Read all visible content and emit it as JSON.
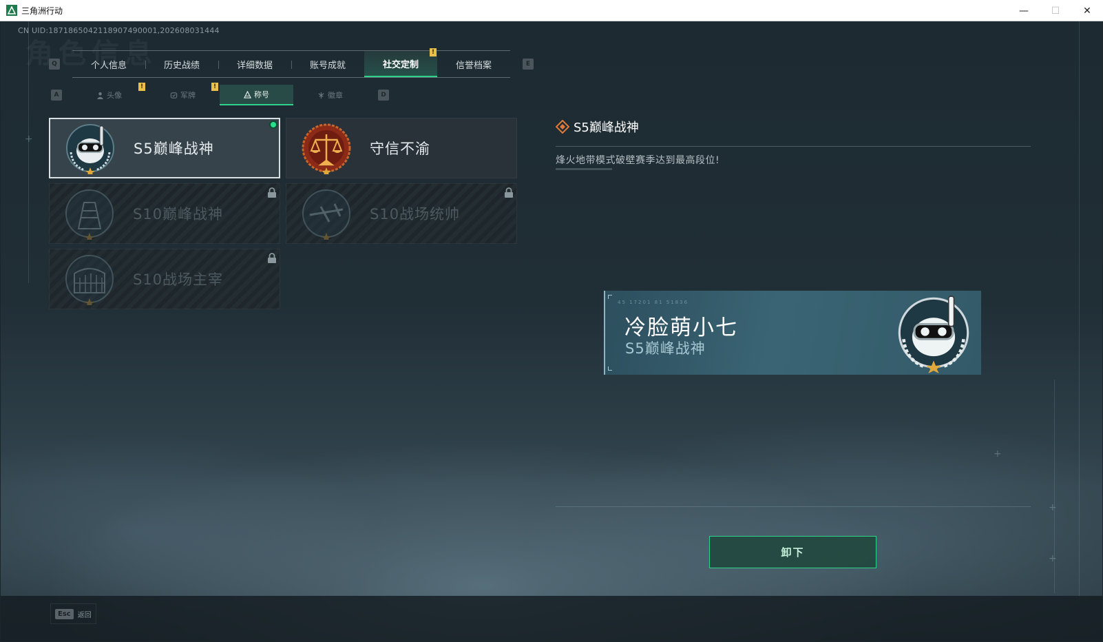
{
  "window": {
    "title": "三角洲行动",
    "minimize": "—",
    "maximize": "☐",
    "close": "✕"
  },
  "uid": "CN UID:1871865042118907490001,202608031444",
  "watermark": "角色信息",
  "tabs": {
    "prev_key": "Q",
    "next_key": "E",
    "items": [
      {
        "label": "个人信息"
      },
      {
        "label": "历史战绩"
      },
      {
        "label": "详细数据"
      },
      {
        "label": "账号成就"
      },
      {
        "label": "社交定制",
        "active": true,
        "notice": "!"
      },
      {
        "label": "信誉档案"
      }
    ]
  },
  "subtabs": {
    "prev_key": "A",
    "next_key": "D",
    "items": [
      {
        "label": "头像",
        "icon": "person-icon",
        "notice": "!"
      },
      {
        "label": "军牌",
        "icon": "dogtag-icon",
        "notice": "!"
      },
      {
        "label": "称号",
        "icon": "title-icon",
        "active": true
      },
      {
        "label": "徽章",
        "icon": "emblem-icon"
      }
    ]
  },
  "titles": [
    {
      "label": "S5巅峰战神",
      "badge": "diver-skull-badge",
      "state": "equipped"
    },
    {
      "label": "守信不渝",
      "badge": "scales-badge",
      "state": "owned"
    },
    {
      "label": "S10巅峰战神",
      "badge": "tower-badge",
      "state": "locked"
    },
    {
      "label": "S10战场统帅",
      "badge": "aircraft-badge",
      "state": "locked"
    },
    {
      "label": "S10战场主宰",
      "badge": "colosseum-badge",
      "state": "locked"
    }
  ],
  "detail": {
    "title": "S5巅峰战神",
    "description": "烽火地带模式破壁赛季达到最高段位!"
  },
  "preview": {
    "deco": "45 17201   81 51836",
    "player_name": "冷脸萌小七",
    "player_title": "S5巅峰战神"
  },
  "actions": {
    "unequip": "卸下"
  },
  "footer": {
    "esc_key": "Esc",
    "esc_label": "返回"
  },
  "colors": {
    "accent": "#2fd38a",
    "notice": "#e9c04b"
  }
}
